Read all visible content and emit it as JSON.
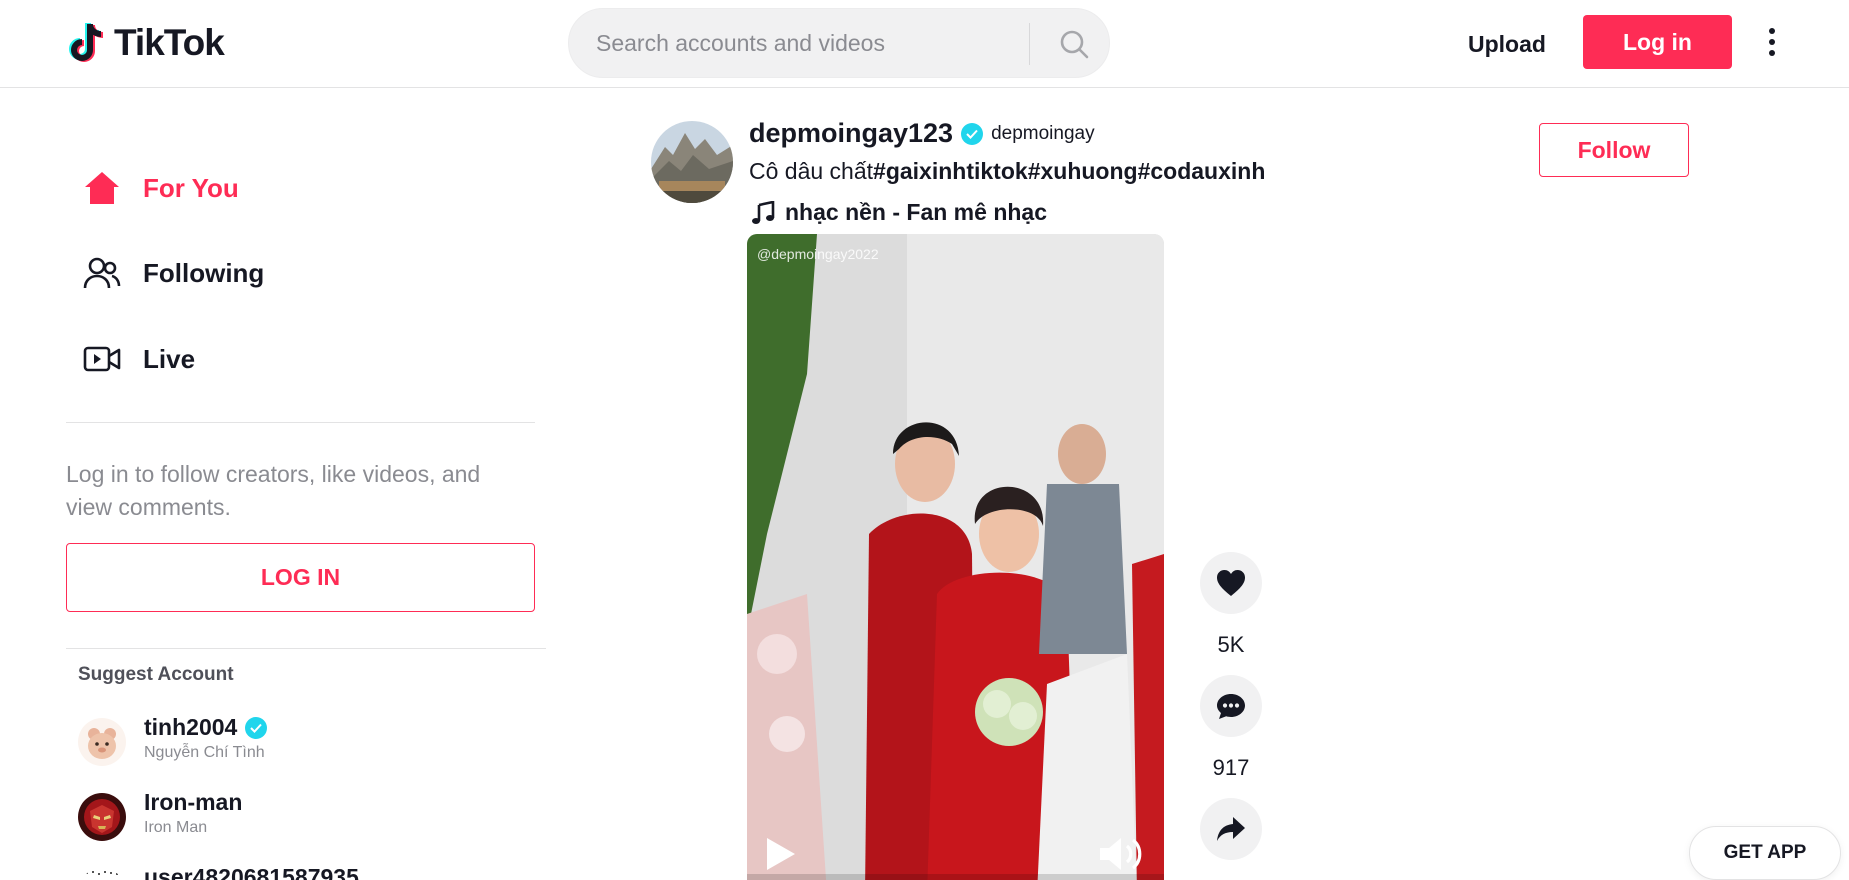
{
  "header": {
    "logo_text": "TikTok",
    "search_placeholder": "Search accounts and videos",
    "upload_label": "Upload",
    "login_label": "Log in"
  },
  "sidebar": {
    "nav": [
      {
        "label": "For You",
        "icon": "home-icon",
        "active": true
      },
      {
        "label": "Following",
        "icon": "users-icon",
        "active": false
      },
      {
        "label": "Live",
        "icon": "live-camera-icon",
        "active": false
      }
    ],
    "login_prompt": "Log in to follow creators, like videos, and view comments.",
    "login_button": "LOG IN",
    "suggest_title": "Suggest Account",
    "accounts": [
      {
        "username": "tinh2004",
        "name": "Nguyễn Chí Tình",
        "verified": true
      },
      {
        "username": "Iron-man",
        "name": "Iron Man",
        "verified": false
      },
      {
        "username": "user4820681587935",
        "name": "",
        "verified": false
      }
    ]
  },
  "post": {
    "username": "depmoingay123",
    "verified": true,
    "nickname": "depmoingay",
    "caption_text": "Cô dâu chất",
    "hashtags": [
      "#gaixinhtiktok",
      "#xuhuong",
      "#codauxinh"
    ],
    "music": "nhạc nền - Fan mê nhạc",
    "follow_label": "Follow",
    "video_watermark_handle": "@depmoingay2022",
    "likes": "5K",
    "comments": "917"
  },
  "get_app_label": "GET APP",
  "colors": {
    "brand": "#fe2c55",
    "verified": "#20d5ec",
    "text": "#161823",
    "muted": "#8a8b91"
  }
}
